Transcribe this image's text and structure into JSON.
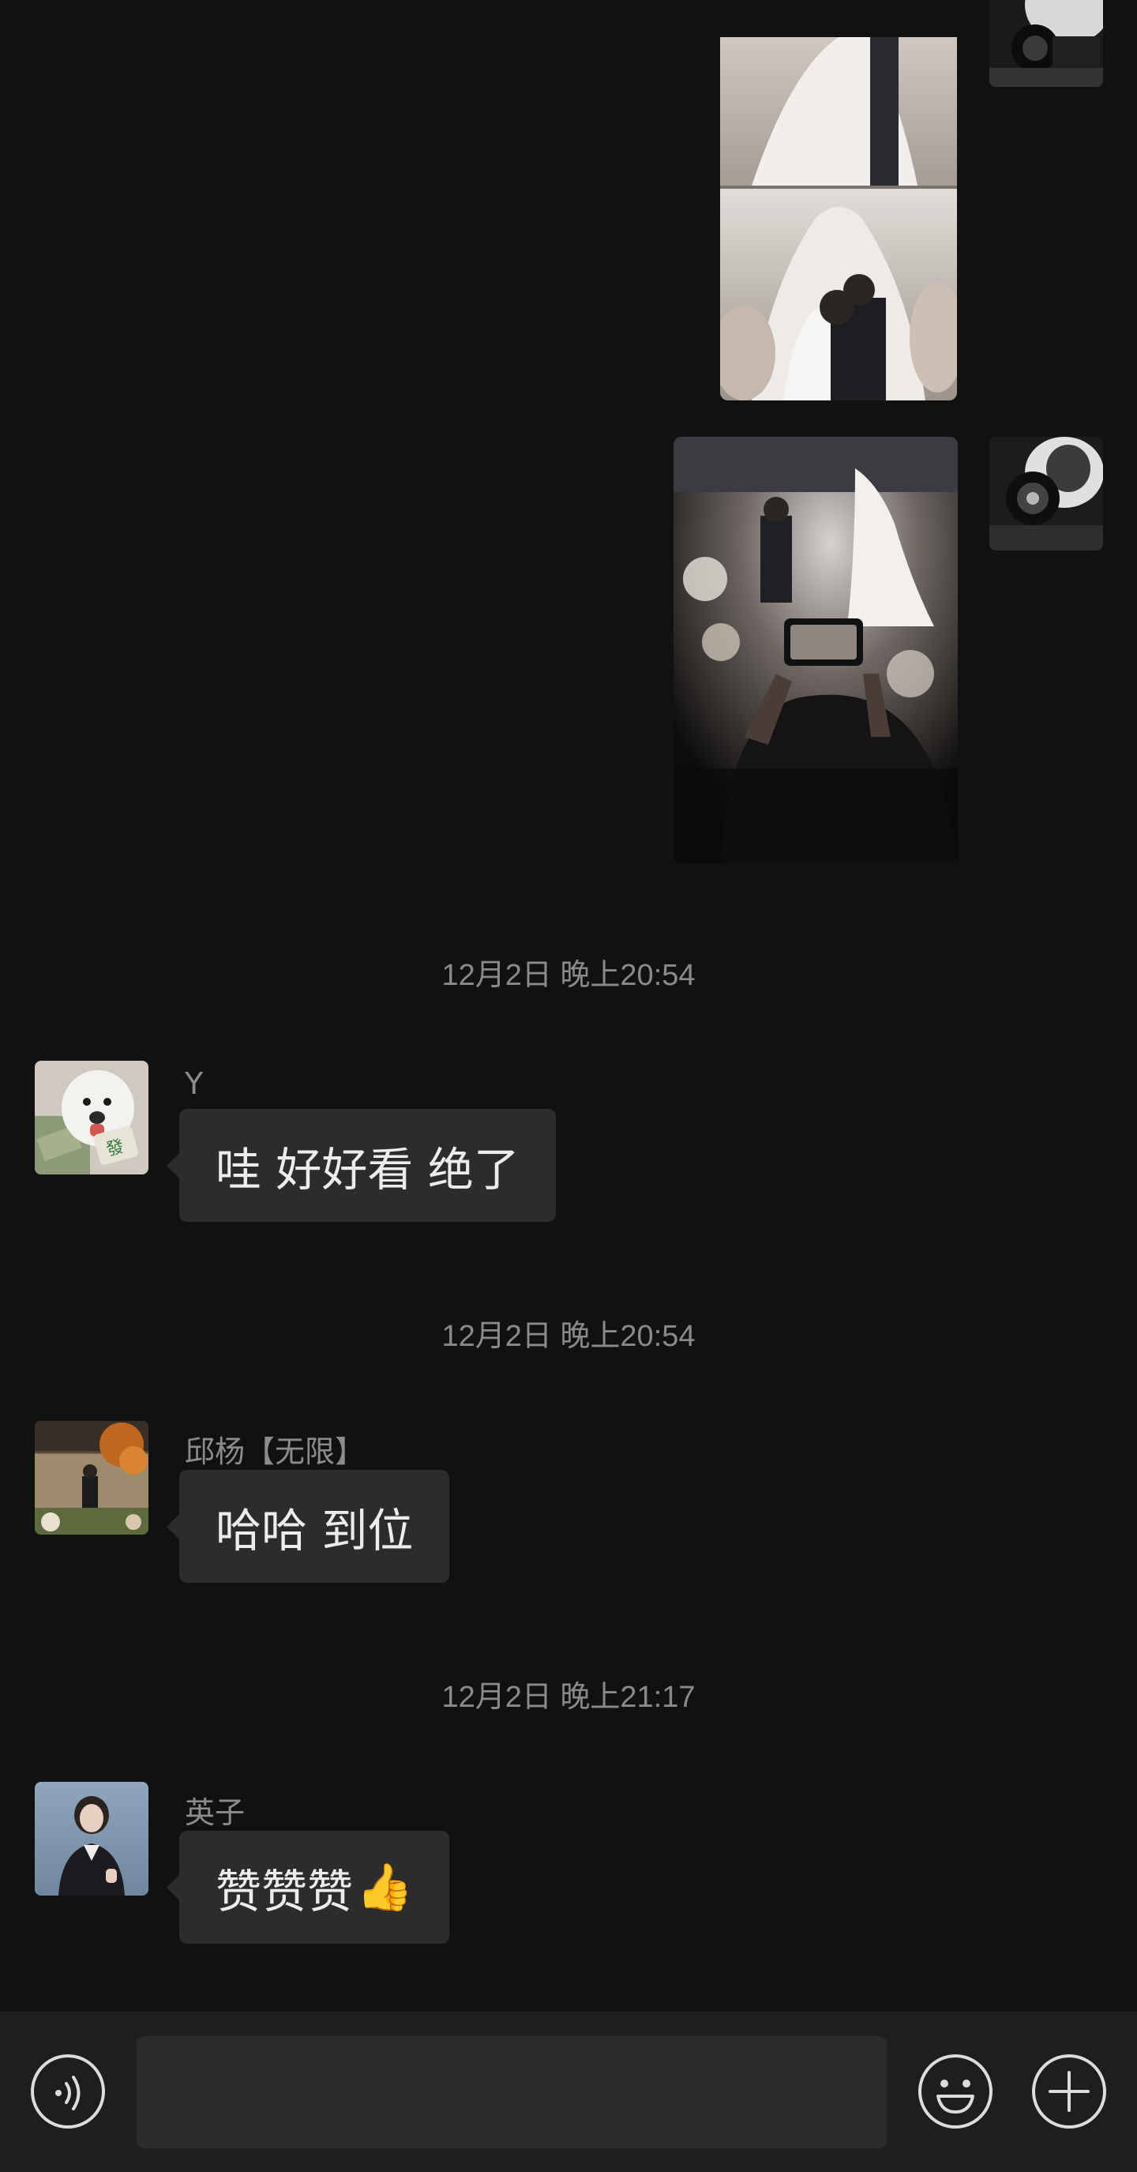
{
  "messages": [
    {
      "type": "image",
      "direction": "outgoing",
      "description_icon": "wedding-photo-collage"
    },
    {
      "type": "image",
      "direction": "outgoing",
      "description_icon": "wedding-reception-photo"
    },
    {
      "type": "timestamp",
      "text": "12月2日 晚上20:54"
    },
    {
      "type": "text",
      "direction": "incoming",
      "sender": "Y",
      "text": "哇 好好看 绝了"
    },
    {
      "type": "timestamp",
      "text": "12月2日 晚上20:54"
    },
    {
      "type": "text",
      "direction": "incoming",
      "sender": "邱杨【无限】",
      "text": "哈哈 到位"
    },
    {
      "type": "timestamp",
      "text": "12月2日 晚上21:17"
    },
    {
      "type": "text",
      "direction": "incoming",
      "sender": "英子",
      "text": "赞赞赞",
      "emoji": "👍"
    }
  ],
  "input_bar": {
    "voice_icon": "voice-icon",
    "emoji_icon": "emoji-icon",
    "add_icon": "plus-icon",
    "placeholder": ""
  },
  "colors": {
    "background": "#111111",
    "bubble": "#2c2c2c",
    "input_bar": "#1e1e1e",
    "meta_text": "#8a8a8a"
  }
}
